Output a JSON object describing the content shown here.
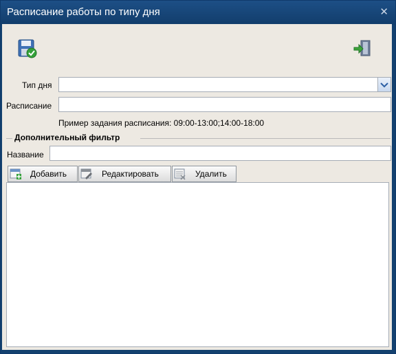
{
  "window": {
    "title": "Расписание работы по типу дня",
    "close_symbol": "✕"
  },
  "toolbar": {
    "save_icon": "save-icon",
    "exit_icon": "exit-icon"
  },
  "form": {
    "day_type_label": "Тип дня",
    "day_type_value": "",
    "schedule_label": "Расписание",
    "schedule_value": "",
    "example_text": "Пример задания расписания: 09:00-13:00;14:00-18:00"
  },
  "filter": {
    "legend": "Дополнительный фильтр",
    "name_label": "Название",
    "name_value": ""
  },
  "list_toolbar": {
    "add_label": "Добавить",
    "edit_label": "Редактировать",
    "delete_label": "Удалить"
  },
  "colors": {
    "titlebar": "#164373",
    "content_bg": "#ede9e2",
    "accent": "#2e6db8"
  }
}
